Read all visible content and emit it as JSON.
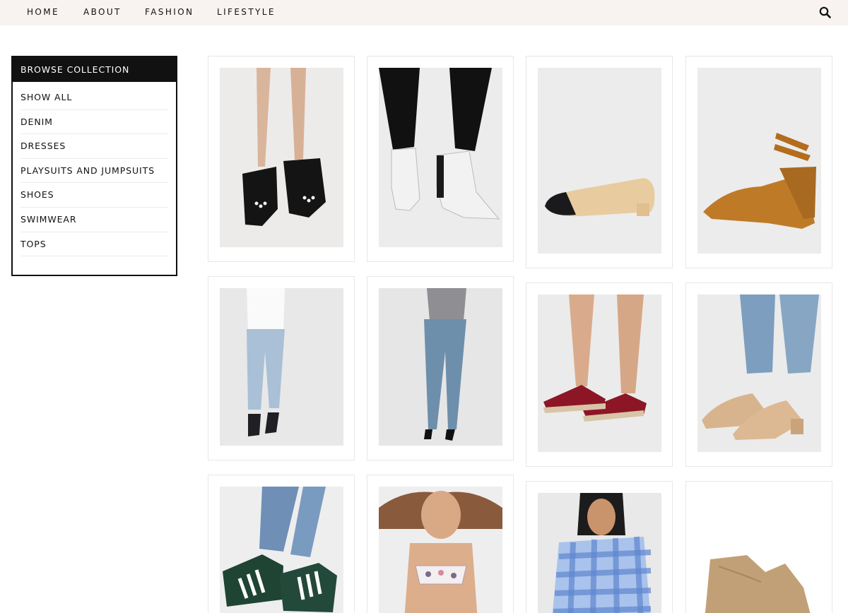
{
  "nav": {
    "links": [
      "HOME",
      "ABOUT",
      "FASHION",
      "LIFESTYLE"
    ],
    "search_icon": "search-icon"
  },
  "sidebar": {
    "title": "BROWSE COLLECTION",
    "items": [
      "SHOW ALL",
      "DENIM",
      "DRESSES",
      "PLAYSUITS AND JUMPSUITS",
      "SHOES",
      "SWIMWEAR",
      "TOPS"
    ]
  },
  "products": [
    {
      "image": "black-pearl-platform-heels"
    },
    {
      "image": "white-ankle-boots-black-jeans"
    },
    {
      "image": "cream-black-cap-toe-flats"
    },
    {
      "image": "tan-suede-wedge-sandals"
    },
    {
      "image": "light-wash-mom-jeans"
    },
    {
      "image": "ripped-skinny-jeans"
    },
    {
      "image": "red-espadrille-sliders"
    },
    {
      "image": "gold-metallic-mules"
    },
    {
      "image": "green-adidas-sneakers"
    },
    {
      "image": "floral-bandeau-bikini"
    },
    {
      "image": "blue-gingham-off-shoulder-top"
    },
    {
      "image": "beige-suede-western-boots"
    }
  ],
  "colors": {
    "nav_background": "#f8f3f0",
    "sidebar_header": "#111111",
    "card_border": "#e7e7e7",
    "photo_background": "#ededed"
  }
}
